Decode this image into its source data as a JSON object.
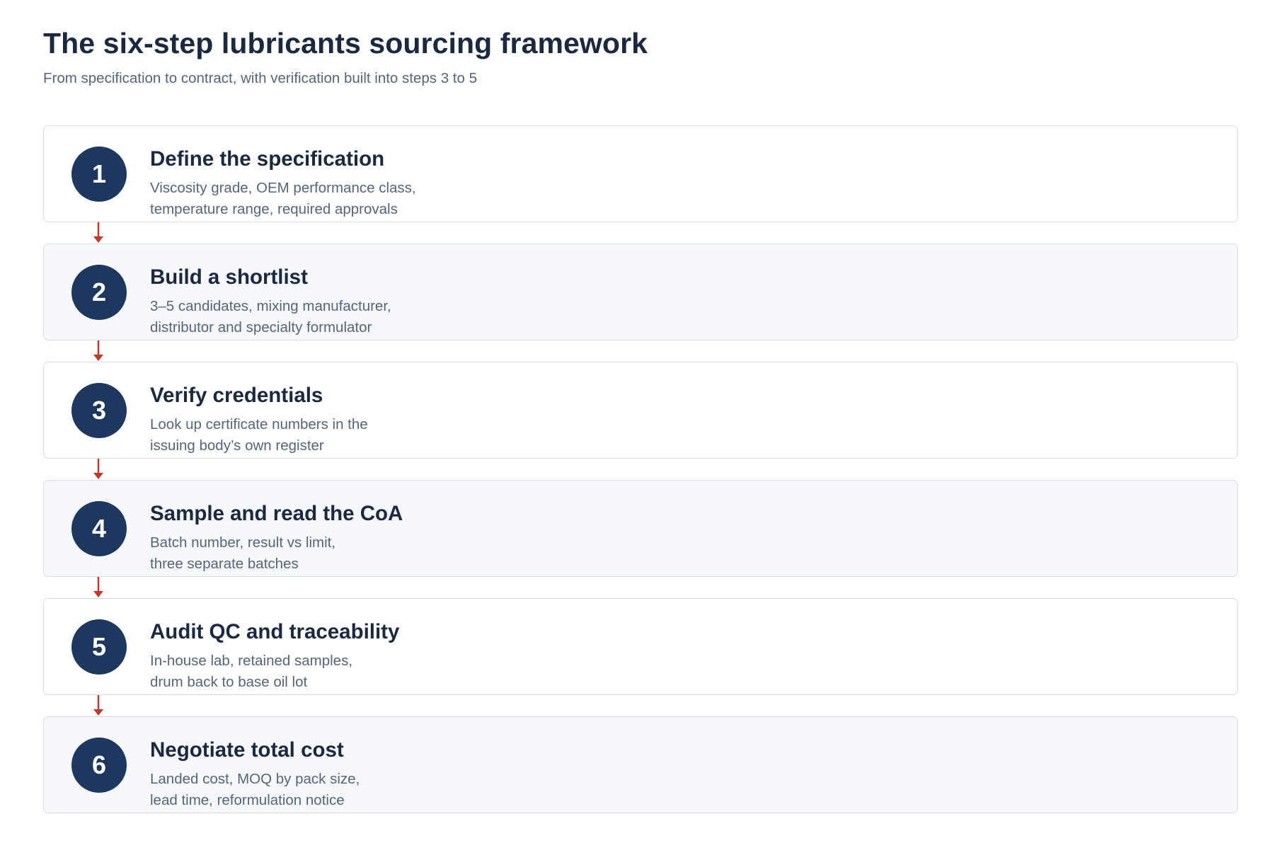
{
  "header": {
    "title": "The six-step lubricants sourcing framework",
    "subtitle": "From specification to contract, with verification built into steps 3 to 5"
  },
  "colors": {
    "badge": "#1d375e",
    "arrow": "#c0392b",
    "card_border": "#d7dde6",
    "card_alt_bg": "#f6f8fc"
  },
  "steps": [
    {
      "number": "1",
      "title": "Define the specification",
      "desc_line1": "Viscosity grade, OEM performance class,",
      "desc_line2": "temperature range, required approvals"
    },
    {
      "number": "2",
      "title": "Build a shortlist",
      "desc_line1": "3–5 candidates, mixing manufacturer,",
      "desc_line2": "distributor and specialty formulator"
    },
    {
      "number": "3",
      "title": "Verify credentials",
      "desc_line1": "Look up certificate numbers in the",
      "desc_line2": "issuing body’s own register"
    },
    {
      "number": "4",
      "title": "Sample and read the CoA",
      "desc_line1": "Batch number, result vs limit,",
      "desc_line2": "three separate batches"
    },
    {
      "number": "5",
      "title": "Audit QC and traceability",
      "desc_line1": "In-house lab, retained samples,",
      "desc_line2": "drum back to base oil lot"
    },
    {
      "number": "6",
      "title": "Negotiate total cost",
      "desc_line1": "Landed cost, MOQ by pack size,",
      "desc_line2": "lead time, reformulation notice"
    }
  ]
}
